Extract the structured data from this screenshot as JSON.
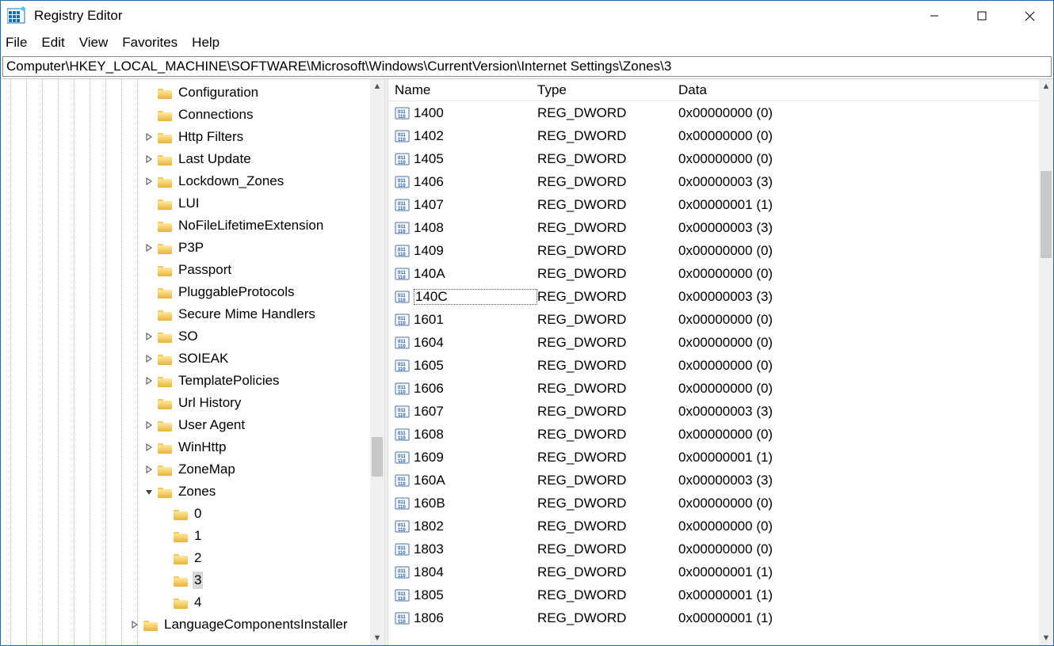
{
  "window": {
    "title": "Registry Editor"
  },
  "menu": {
    "file": "File",
    "edit": "Edit",
    "view": "View",
    "favorites": "Favorites",
    "help": "Help"
  },
  "address": "Computer\\HKEY_LOCAL_MACHINE\\SOFTWARE\\Microsoft\\Windows\\CurrentVersion\\Internet Settings\\Zones\\3",
  "tree": {
    "items": [
      {
        "label": "Configuration",
        "expander": "",
        "indent": "indent1"
      },
      {
        "label": "Connections",
        "expander": "",
        "indent": "indent1"
      },
      {
        "label": "Http Filters",
        "expander": ">",
        "indent": "indent1"
      },
      {
        "label": "Last Update",
        "expander": ">",
        "indent": "indent1"
      },
      {
        "label": "Lockdown_Zones",
        "expander": ">",
        "indent": "indent1"
      },
      {
        "label": "LUI",
        "expander": "",
        "indent": "indent1"
      },
      {
        "label": "NoFileLifetimeExtension",
        "expander": "",
        "indent": "indent1"
      },
      {
        "label": "P3P",
        "expander": ">",
        "indent": "indent1"
      },
      {
        "label": "Passport",
        "expander": "",
        "indent": "indent1"
      },
      {
        "label": "PluggableProtocols",
        "expander": "",
        "indent": "indent1"
      },
      {
        "label": "Secure Mime Handlers",
        "expander": "",
        "indent": "indent1"
      },
      {
        "label": "SO",
        "expander": ">",
        "indent": "indent1"
      },
      {
        "label": "SOIEAK",
        "expander": ">",
        "indent": "indent1"
      },
      {
        "label": "TemplatePolicies",
        "expander": ">",
        "indent": "indent1"
      },
      {
        "label": "Url History",
        "expander": "",
        "indent": "indent1"
      },
      {
        "label": "User Agent",
        "expander": ">",
        "indent": "indent1"
      },
      {
        "label": "WinHttp",
        "expander": ">",
        "indent": "indent1"
      },
      {
        "label": "ZoneMap",
        "expander": ">",
        "indent": "indent1"
      },
      {
        "label": "Zones",
        "expander": "v",
        "indent": "indent1"
      },
      {
        "label": "0",
        "expander": "",
        "indent": "zoneChild"
      },
      {
        "label": "1",
        "expander": "",
        "indent": "zoneChild"
      },
      {
        "label": "2",
        "expander": "",
        "indent": "zoneChild"
      },
      {
        "label": "3",
        "expander": "",
        "indent": "zoneChild",
        "selected": true
      },
      {
        "label": "4",
        "expander": "",
        "indent": "zoneChild"
      },
      {
        "label": "LanguageComponentsInstaller",
        "expander": ">",
        "indent": "indent0"
      }
    ]
  },
  "columns": {
    "name": "Name",
    "type": "Type",
    "data": "Data"
  },
  "values": [
    {
      "name": "1400",
      "type": "REG_DWORD",
      "data": "0x00000000 (0)"
    },
    {
      "name": "1402",
      "type": "REG_DWORD",
      "data": "0x00000000 (0)"
    },
    {
      "name": "1405",
      "type": "REG_DWORD",
      "data": "0x00000000 (0)"
    },
    {
      "name": "1406",
      "type": "REG_DWORD",
      "data": "0x00000003 (3)"
    },
    {
      "name": "1407",
      "type": "REG_DWORD",
      "data": "0x00000001 (1)"
    },
    {
      "name": "1408",
      "type": "REG_DWORD",
      "data": "0x00000003 (3)"
    },
    {
      "name": "1409",
      "type": "REG_DWORD",
      "data": "0x00000000 (0)"
    },
    {
      "name": "140A",
      "type": "REG_DWORD",
      "data": "0x00000000 (0)"
    },
    {
      "name": "140C",
      "type": "REG_DWORD",
      "data": "0x00000003 (3)",
      "focused": true
    },
    {
      "name": "1601",
      "type": "REG_DWORD",
      "data": "0x00000000 (0)"
    },
    {
      "name": "1604",
      "type": "REG_DWORD",
      "data": "0x00000000 (0)"
    },
    {
      "name": "1605",
      "type": "REG_DWORD",
      "data": "0x00000000 (0)"
    },
    {
      "name": "1606",
      "type": "REG_DWORD",
      "data": "0x00000000 (0)"
    },
    {
      "name": "1607",
      "type": "REG_DWORD",
      "data": "0x00000003 (3)"
    },
    {
      "name": "1608",
      "type": "REG_DWORD",
      "data": "0x00000000 (0)"
    },
    {
      "name": "1609",
      "type": "REG_DWORD",
      "data": "0x00000001 (1)"
    },
    {
      "name": "160A",
      "type": "REG_DWORD",
      "data": "0x00000003 (3)"
    },
    {
      "name": "160B",
      "type": "REG_DWORD",
      "data": "0x00000000 (0)"
    },
    {
      "name": "1802",
      "type": "REG_DWORD",
      "data": "0x00000000 (0)"
    },
    {
      "name": "1803",
      "type": "REG_DWORD",
      "data": "0x00000000 (0)"
    },
    {
      "name": "1804",
      "type": "REG_DWORD",
      "data": "0x00000001 (1)"
    },
    {
      "name": "1805",
      "type": "REG_DWORD",
      "data": "0x00000001 (1)"
    },
    {
      "name": "1806",
      "type": "REG_DWORD",
      "data": "0x00000001 (1)"
    }
  ],
  "scroll": {
    "tree": {
      "thumbTop": 452,
      "thumbHeight": 50
    },
    "list": {
      "thumbTop": 116,
      "thumbHeight": 110
    }
  }
}
